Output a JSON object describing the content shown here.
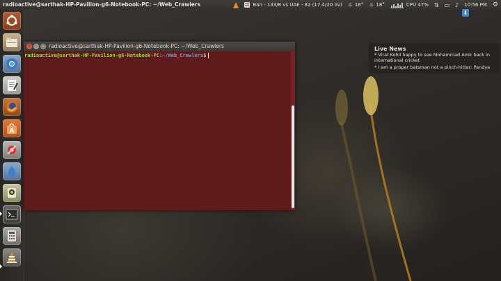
{
  "top_panel": {
    "window_title": "radioactive@sarthak-HP-Pavilion-g6-Notebook-PC: ~/Web_Crawlers",
    "cricket_score": "Ban - 133/8 vs UAE - 82 (17.4/20 ov)",
    "weather_1": "18°",
    "weather_2": "18°",
    "cpu": "CPU 47%",
    "clock": "10:56 PM"
  },
  "launcher": {
    "icons": [
      "ubuntu-dash-icon",
      "files-icon",
      "chromium-icon",
      "text-editor-icon",
      "firefox-icon",
      "software-center-icon",
      "settings-icon",
      "water-drop-icon",
      "webcam-icon",
      "terminal-icon",
      "calculator-icon",
      "vlc-icon"
    ]
  },
  "terminal": {
    "title": "radioactive@sarthak-HP-Pavilion-g6-Notebook-PC: ~/Web_Crawlers",
    "prompt_user": "radioactive@sarthak-HP-Pavilion-g6-Notebook-PC",
    "prompt_colon": ":",
    "prompt_path": "~/Web_Crawlers",
    "prompt_symbol": "$"
  },
  "news": {
    "heading": "Live News",
    "items": [
      "*  Virat Kohli happy to see Mohammad Amir back in international cricket",
      "*  I am a proper batsman not a pinch-hitter: Pandya"
    ]
  },
  "colors": {
    "terminal_bg": "#5e1b1b",
    "prompt_user": "#8ae234",
    "prompt_path": "#729fcf",
    "accent_orange": "#f28a1a"
  }
}
